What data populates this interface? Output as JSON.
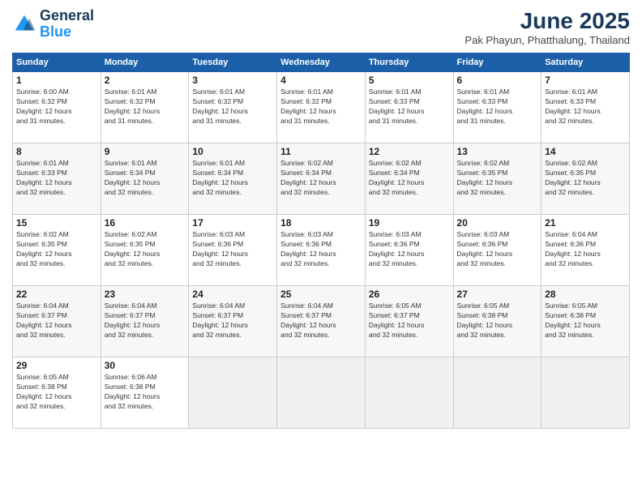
{
  "logo": {
    "line1": "General",
    "line2": "Blue"
  },
  "title": "June 2025",
  "subtitle": "Pak Phayun, Phatthalung, Thailand",
  "weekdays": [
    "Sunday",
    "Monday",
    "Tuesday",
    "Wednesday",
    "Thursday",
    "Friday",
    "Saturday"
  ],
  "weeks": [
    [
      {
        "day": "1",
        "info": "Sunrise: 6:00 AM\nSunset: 6:32 PM\nDaylight: 12 hours\nand 31 minutes."
      },
      {
        "day": "2",
        "info": "Sunrise: 6:01 AM\nSunset: 6:32 PM\nDaylight: 12 hours\nand 31 minutes."
      },
      {
        "day": "3",
        "info": "Sunrise: 6:01 AM\nSunset: 6:32 PM\nDaylight: 12 hours\nand 31 minutes."
      },
      {
        "day": "4",
        "info": "Sunrise: 6:01 AM\nSunset: 6:32 PM\nDaylight: 12 hours\nand 31 minutes."
      },
      {
        "day": "5",
        "info": "Sunrise: 6:01 AM\nSunset: 6:33 PM\nDaylight: 12 hours\nand 31 minutes."
      },
      {
        "day": "6",
        "info": "Sunrise: 6:01 AM\nSunset: 6:33 PM\nDaylight: 12 hours\nand 31 minutes."
      },
      {
        "day": "7",
        "info": "Sunrise: 6:01 AM\nSunset: 6:33 PM\nDaylight: 12 hours\nand 32 minutes."
      }
    ],
    [
      {
        "day": "8",
        "info": "Sunrise: 6:01 AM\nSunset: 6:33 PM\nDaylight: 12 hours\nand 32 minutes."
      },
      {
        "day": "9",
        "info": "Sunrise: 6:01 AM\nSunset: 6:34 PM\nDaylight: 12 hours\nand 32 minutes."
      },
      {
        "day": "10",
        "info": "Sunrise: 6:01 AM\nSunset: 6:34 PM\nDaylight: 12 hours\nand 32 minutes."
      },
      {
        "day": "11",
        "info": "Sunrise: 6:02 AM\nSunset: 6:34 PM\nDaylight: 12 hours\nand 32 minutes."
      },
      {
        "day": "12",
        "info": "Sunrise: 6:02 AM\nSunset: 6:34 PM\nDaylight: 12 hours\nand 32 minutes."
      },
      {
        "day": "13",
        "info": "Sunrise: 6:02 AM\nSunset: 6:35 PM\nDaylight: 12 hours\nand 32 minutes."
      },
      {
        "day": "14",
        "info": "Sunrise: 6:02 AM\nSunset: 6:35 PM\nDaylight: 12 hours\nand 32 minutes."
      }
    ],
    [
      {
        "day": "15",
        "info": "Sunrise: 6:02 AM\nSunset: 6:35 PM\nDaylight: 12 hours\nand 32 minutes."
      },
      {
        "day": "16",
        "info": "Sunrise: 6:02 AM\nSunset: 6:35 PM\nDaylight: 12 hours\nand 32 minutes."
      },
      {
        "day": "17",
        "info": "Sunrise: 6:03 AM\nSunset: 6:36 PM\nDaylight: 12 hours\nand 32 minutes."
      },
      {
        "day": "18",
        "info": "Sunrise: 6:03 AM\nSunset: 6:36 PM\nDaylight: 12 hours\nand 32 minutes."
      },
      {
        "day": "19",
        "info": "Sunrise: 6:03 AM\nSunset: 6:36 PM\nDaylight: 12 hours\nand 32 minutes."
      },
      {
        "day": "20",
        "info": "Sunrise: 6:03 AM\nSunset: 6:36 PM\nDaylight: 12 hours\nand 32 minutes."
      },
      {
        "day": "21",
        "info": "Sunrise: 6:04 AM\nSunset: 6:36 PM\nDaylight: 12 hours\nand 32 minutes."
      }
    ],
    [
      {
        "day": "22",
        "info": "Sunrise: 6:04 AM\nSunset: 6:37 PM\nDaylight: 12 hours\nand 32 minutes."
      },
      {
        "day": "23",
        "info": "Sunrise: 6:04 AM\nSunset: 6:37 PM\nDaylight: 12 hours\nand 32 minutes."
      },
      {
        "day": "24",
        "info": "Sunrise: 6:04 AM\nSunset: 6:37 PM\nDaylight: 12 hours\nand 32 minutes."
      },
      {
        "day": "25",
        "info": "Sunrise: 6:04 AM\nSunset: 6:37 PM\nDaylight: 12 hours\nand 32 minutes."
      },
      {
        "day": "26",
        "info": "Sunrise: 6:05 AM\nSunset: 6:37 PM\nDaylight: 12 hours\nand 32 minutes."
      },
      {
        "day": "27",
        "info": "Sunrise: 6:05 AM\nSunset: 6:38 PM\nDaylight: 12 hours\nand 32 minutes."
      },
      {
        "day": "28",
        "info": "Sunrise: 6:05 AM\nSunset: 6:38 PM\nDaylight: 12 hours\nand 32 minutes."
      }
    ],
    [
      {
        "day": "29",
        "info": "Sunrise: 6:05 AM\nSunset: 6:38 PM\nDaylight: 12 hours\nand 32 minutes."
      },
      {
        "day": "30",
        "info": "Sunrise: 6:06 AM\nSunset: 6:38 PM\nDaylight: 12 hours\nand 32 minutes."
      },
      null,
      null,
      null,
      null,
      null
    ]
  ]
}
